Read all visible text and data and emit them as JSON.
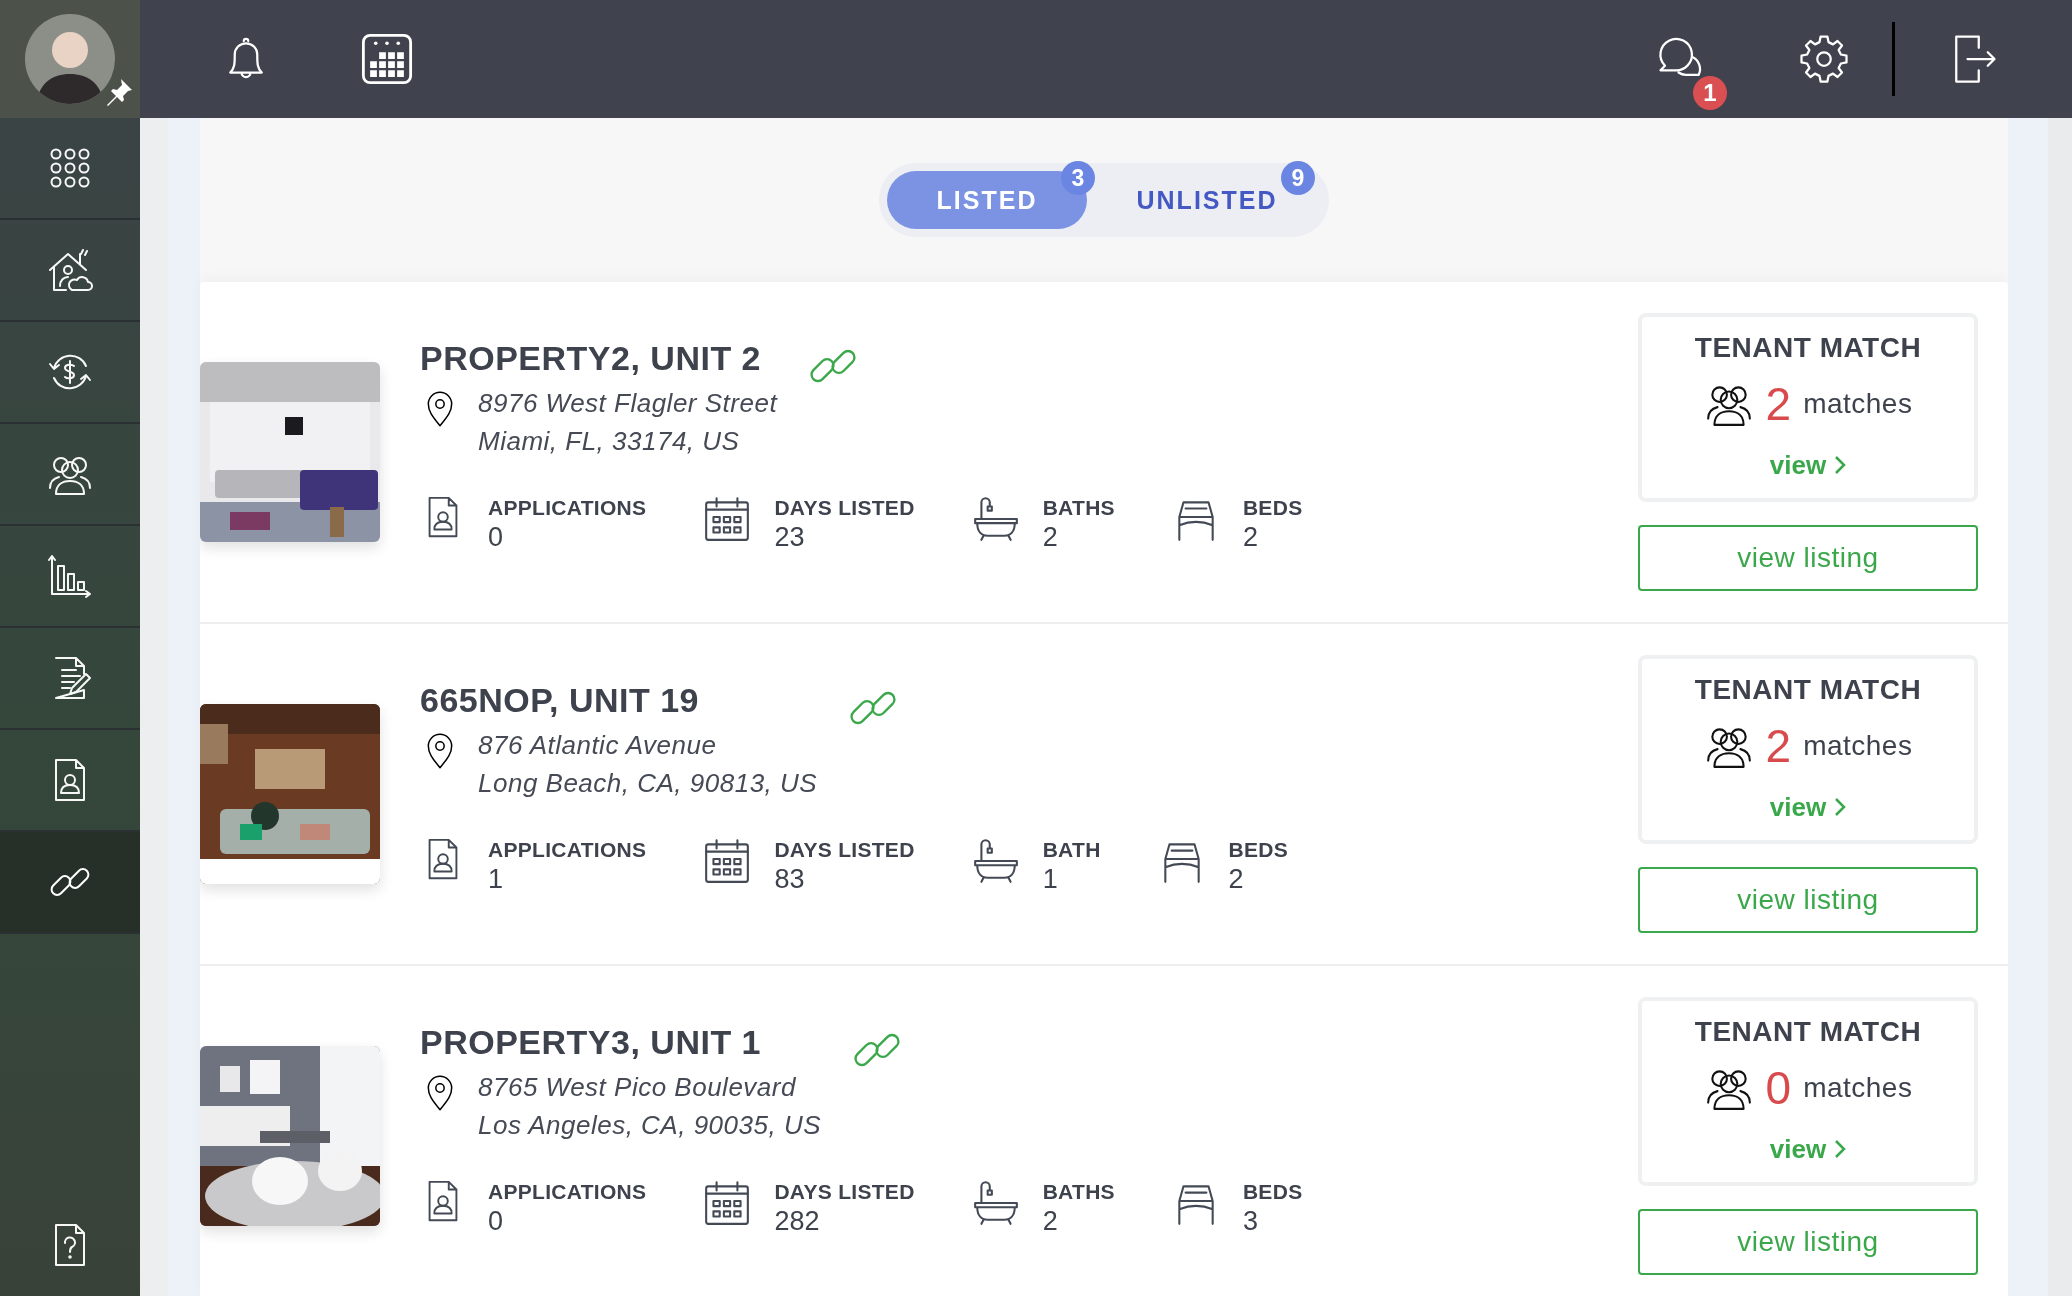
{
  "sidebar": {
    "items": [
      {
        "kind": "apps",
        "selected": false
      },
      {
        "kind": "property",
        "selected": false
      },
      {
        "kind": "payments",
        "selected": false
      },
      {
        "kind": "tenants",
        "selected": false
      },
      {
        "kind": "reports",
        "selected": false
      },
      {
        "kind": "documents",
        "selected": false
      },
      {
        "kind": "applicants",
        "selected": false
      },
      {
        "kind": "listings",
        "selected": true
      },
      {
        "kind": "help",
        "selected": false
      }
    ]
  },
  "top_bar": {
    "messages_badge": "1"
  },
  "tabs": [
    {
      "label": "LISTED",
      "count": "3",
      "selected": true
    },
    {
      "label": "UNLISTED",
      "count": "9",
      "selected": false
    }
  ],
  "listings": [
    {
      "title": "PROPERTY2, UNIT 2",
      "address_line_1": "8976 West Flagler Street",
      "address_line_2": "Miami, FL, 33174, US",
      "stats": [
        {
          "kind": "applications",
          "label": "APPLICATIONS",
          "value": "0"
        },
        {
          "kind": "days",
          "label": "DAYS LISTED",
          "value": "23"
        },
        {
          "kind": "baths",
          "label": "BATHS",
          "value": "2"
        },
        {
          "kind": "beds",
          "label": "BEDS",
          "value": "2"
        }
      ],
      "tenant_match": {
        "title": "TENANT MATCH",
        "count": "2",
        "count_label": "matches",
        "link": "view"
      },
      "button": "view listing"
    },
    {
      "title": "665NOP, UNIT 19",
      "address_line_1": "876 Atlantic Avenue",
      "address_line_2": "Long Beach, CA, 90813, US",
      "stats": [
        {
          "kind": "applications",
          "label": "APPLICATIONS",
          "value": "1"
        },
        {
          "kind": "days",
          "label": "DAYS LISTED",
          "value": "83"
        },
        {
          "kind": "baths",
          "label": "BATH",
          "value": "1"
        },
        {
          "kind": "beds",
          "label": "BEDS",
          "value": "2"
        }
      ],
      "tenant_match": {
        "title": "TENANT MATCH",
        "count": "2",
        "count_label": "matches",
        "link": "view"
      },
      "button": "view listing"
    },
    {
      "title": "PROPERTY3, UNIT 1",
      "address_line_1": "8765 West Pico Boulevard",
      "address_line_2": "Los Angeles, CA, 90035, US",
      "stats": [
        {
          "kind": "applications",
          "label": "APPLICATIONS",
          "value": "0"
        },
        {
          "kind": "days",
          "label": "DAYS LISTED",
          "value": "282"
        },
        {
          "kind": "baths",
          "label": "BATHS",
          "value": "2"
        },
        {
          "kind": "beds",
          "label": "BEDS",
          "value": "3"
        }
      ],
      "tenant_match": {
        "title": "TENANT MATCH",
        "count": "0",
        "count_label": "matches",
        "link": "view"
      },
      "button": "view listing"
    }
  ]
}
